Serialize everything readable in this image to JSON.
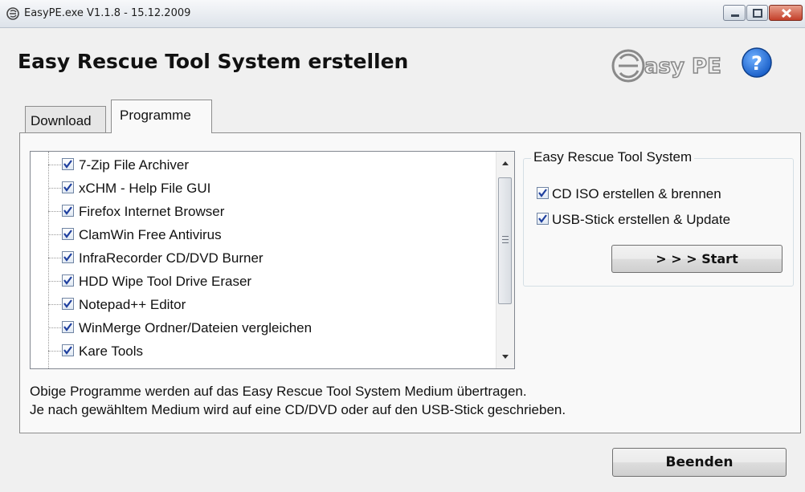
{
  "window": {
    "title": "EasyPE.exe V1.1.8 - 15.12.2009"
  },
  "header": {
    "title": "Easy Rescue Tool System erstellen",
    "logo_text": "asy PE",
    "help_icon": "question-circle-icon"
  },
  "tabs": [
    {
      "label": "Download",
      "selected": false
    },
    {
      "label": "Programme",
      "selected": true
    }
  ],
  "programs": [
    {
      "label": "7-Zip File Archiver",
      "checked": true
    },
    {
      "label": "xCHM - Help File GUI",
      "checked": true
    },
    {
      "label": "Firefox Internet Browser",
      "checked": true
    },
    {
      "label": "ClamWin Free Antivirus",
      "checked": true
    },
    {
      "label": "InfraRecorder CD/DVD Burner",
      "checked": true
    },
    {
      "label": "HDD Wipe Tool Drive Eraser",
      "checked": true
    },
    {
      "label": "Notepad++ Editor",
      "checked": true
    },
    {
      "label": "WinMerge Ordner/Dateien vergleichen",
      "checked": true
    },
    {
      "label": "Kare Tools",
      "checked": true
    }
  ],
  "group": {
    "title": "Easy Rescue Tool System",
    "options": [
      {
        "label": "CD ISO erstellen & brennen",
        "checked": true
      },
      {
        "label": "USB-Stick erstellen & Update",
        "checked": true
      }
    ],
    "start_label": "> > > Start"
  },
  "info": {
    "line1": "Obige Programme werden auf das Easy Rescue Tool System Medium übertragen.",
    "line2": "Je nach gewähltem Medium wird auf eine CD/DVD oder auf den USB-Stick geschrieben."
  },
  "footer": {
    "close_label": "Beenden"
  },
  "colors": {
    "help_blue": "#1a5fc8",
    "check_blue": "#1e3f9e"
  }
}
